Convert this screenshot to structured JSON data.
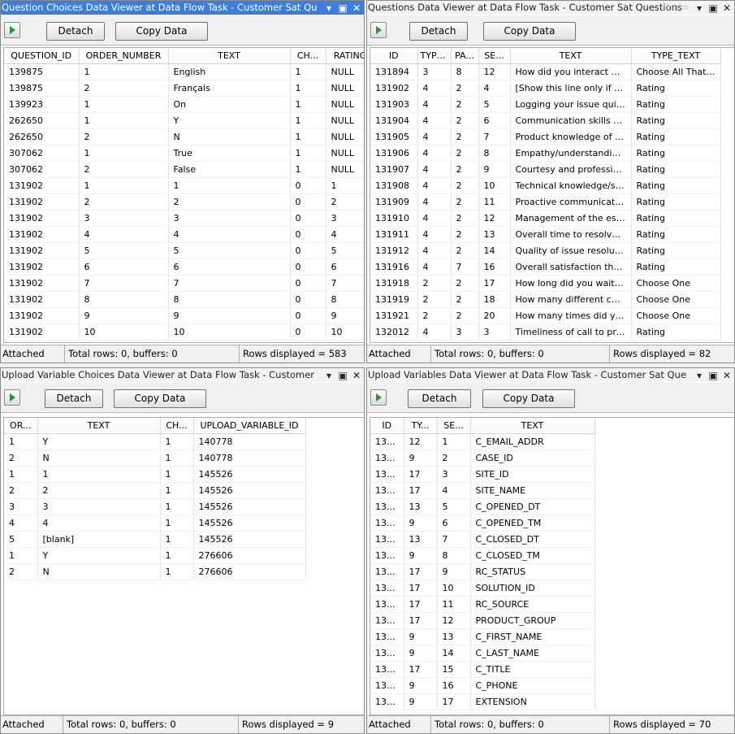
{
  "common": {
    "detach_label": "Detach",
    "copy_label": "Copy Data",
    "status_attached": "Attached",
    "status_total": "Total rows: 0, buffers: 0"
  },
  "panes": [
    {
      "title": "Question Choices Data Viewer at Data Flow Task - Customer Sat Questions",
      "rows_displayed": "Rows displayed = 583",
      "columns": [
        "QUESTION_ID",
        "ORDER_NUMBER",
        "TEXT",
        "CH...",
        "RATING"
      ],
      "rows": [
        [
          "139875",
          "1",
          "English",
          "1",
          "NULL"
        ],
        [
          "139875",
          "2",
          "Français",
          "1",
          "NULL"
        ],
        [
          "139923",
          "1",
          "On",
          "1",
          "NULL"
        ],
        [
          "262650",
          "1",
          "Y",
          "1",
          "NULL"
        ],
        [
          "262650",
          "2",
          "N",
          "1",
          "NULL"
        ],
        [
          "307062",
          "1",
          "True",
          "1",
          "NULL"
        ],
        [
          "307062",
          "2",
          "False",
          "1",
          "NULL"
        ],
        [
          "131902",
          "1",
          "1",
          "0",
          "1"
        ],
        [
          "131902",
          "2",
          "2",
          "0",
          "2"
        ],
        [
          "131902",
          "3",
          "3",
          "0",
          "3"
        ],
        [
          "131902",
          "4",
          "4",
          "0",
          "4"
        ],
        [
          "131902",
          "5",
          "5",
          "0",
          "5"
        ],
        [
          "131902",
          "6",
          "6",
          "0",
          "6"
        ],
        [
          "131902",
          "7",
          "7",
          "0",
          "7"
        ],
        [
          "131902",
          "8",
          "8",
          "0",
          "8"
        ],
        [
          "131902",
          "9",
          "9",
          "0",
          "9"
        ],
        [
          "131902",
          "10",
          "10",
          "0",
          "10"
        ]
      ]
    },
    {
      "title": "Questions Data Viewer at Data Flow Task - Customer Sat Questions",
      "rows_displayed": "Rows displayed = 82",
      "columns": [
        "ID",
        "TYPE...",
        "PA...",
        "SE...",
        "TEXT",
        "TYPE_TEXT"
      ],
      "rows": [
        [
          "131894",
          "3",
          "8",
          "12",
          "How did you interact with...",
          "Choose All That Apply"
        ],
        [
          "131902",
          "4",
          "2",
          "4",
          "[Show this line only if QID...",
          "Rating"
        ],
        [
          "131903",
          "4",
          "2",
          "5",
          "Logging your issue quickly...",
          "Rating"
        ],
        [
          "131904",
          "4",
          "2",
          "6",
          "Communication skills of su...",
          "Rating"
        ],
        [
          "131905",
          "4",
          "2",
          "7",
          "Product knowledge of the...",
          "Rating"
        ],
        [
          "131906",
          "4",
          "2",
          "8",
          "Empathy/understanding t...",
          "Rating"
        ],
        [
          "131907",
          "4",
          "2",
          "9",
          "Courtesy and professiona...",
          "Rating"
        ],
        [
          "131908",
          "4",
          "2",
          "10",
          "Technical knowledge/skills...",
          "Rating"
        ],
        [
          "131909",
          "4",
          "2",
          "11",
          "Proactive communication ...",
          "Rating"
        ],
        [
          "131910",
          "4",
          "2",
          "12",
          "Management of the escal...",
          "Rating"
        ],
        [
          "131911",
          "4",
          "2",
          "13",
          "Overall time to resolve yo...",
          "Rating"
        ],
        [
          "131912",
          "4",
          "2",
          "14",
          "Quality of issue resolution...",
          "Rating"
        ],
        [
          "131916",
          "4",
          "7",
          "16",
          "Overall satisfaction the T...",
          "Rating"
        ],
        [
          "131918",
          "2",
          "2",
          "17",
          "How long did you wait on ...",
          "Choose One"
        ],
        [
          "131919",
          "2",
          "2",
          "18",
          "How many different custo...",
          "Choose One"
        ],
        [
          "131921",
          "2",
          "2",
          "20",
          "How many times did you ...",
          "Choose One"
        ],
        [
          "132012",
          "4",
          "3",
          "3",
          "Timeliness of call to provi...",
          "Rating"
        ]
      ]
    },
    {
      "title": "Upload Variable Choices Data Viewer at Data Flow Task - Customer Sat Q...",
      "rows_displayed": "Rows displayed = 9",
      "columns": [
        "OR...",
        "TEXT",
        "CH...",
        "UPLOAD_VARIABLE_ID"
      ],
      "rows": [
        [
          "1",
          "Y",
          "1",
          "140778"
        ],
        [
          "2",
          "N",
          "1",
          "140778"
        ],
        [
          "1",
          "1",
          "1",
          "145526"
        ],
        [
          "2",
          "2",
          "1",
          "145526"
        ],
        [
          "3",
          "3",
          "1",
          "145526"
        ],
        [
          "4",
          "4",
          "1",
          "145526"
        ],
        [
          "5",
          "[blank]",
          "1",
          "145526"
        ],
        [
          "1",
          "Y",
          "1",
          "276606"
        ],
        [
          "2",
          "N",
          "1",
          "276606"
        ]
      ]
    },
    {
      "title": "Upload Variables Data Viewer at Data Flow Task - Customer Sat Questions",
      "rows_displayed": "Rows displayed = 70",
      "columns": [
        "ID",
        "TY...",
        "SE...",
        "TEXT"
      ],
      "rows": [
        [
          "13...",
          "12",
          "1",
          "C_EMAIL_ADDR"
        ],
        [
          "13...",
          "9",
          "2",
          "CASE_ID"
        ],
        [
          "13...",
          "17",
          "3",
          "SITE_ID"
        ],
        [
          "13...",
          "17",
          "4",
          "SITE_NAME"
        ],
        [
          "13...",
          "13",
          "5",
          "C_OPENED_DT"
        ],
        [
          "13...",
          "9",
          "6",
          "C_OPENED_TM"
        ],
        [
          "13...",
          "13",
          "7",
          "C_CLOSED_DT"
        ],
        [
          "13...",
          "9",
          "8",
          "C_CLOSED_TM"
        ],
        [
          "13...",
          "17",
          "9",
          "RC_STATUS"
        ],
        [
          "13...",
          "17",
          "10",
          "SOLUTION_ID"
        ],
        [
          "13...",
          "17",
          "11",
          "RC_SOURCE"
        ],
        [
          "13...",
          "17",
          "12",
          "PRODUCT_GROUP"
        ],
        [
          "13...",
          "9",
          "13",
          "C_FIRST_NAME"
        ],
        [
          "13...",
          "9",
          "14",
          "C_LAST_NAME"
        ],
        [
          "13...",
          "17",
          "15",
          "C_TITLE"
        ],
        [
          "13...",
          "9",
          "16",
          "C_PHONE"
        ],
        [
          "13...",
          "9",
          "17",
          "EXTENSION"
        ]
      ]
    }
  ]
}
